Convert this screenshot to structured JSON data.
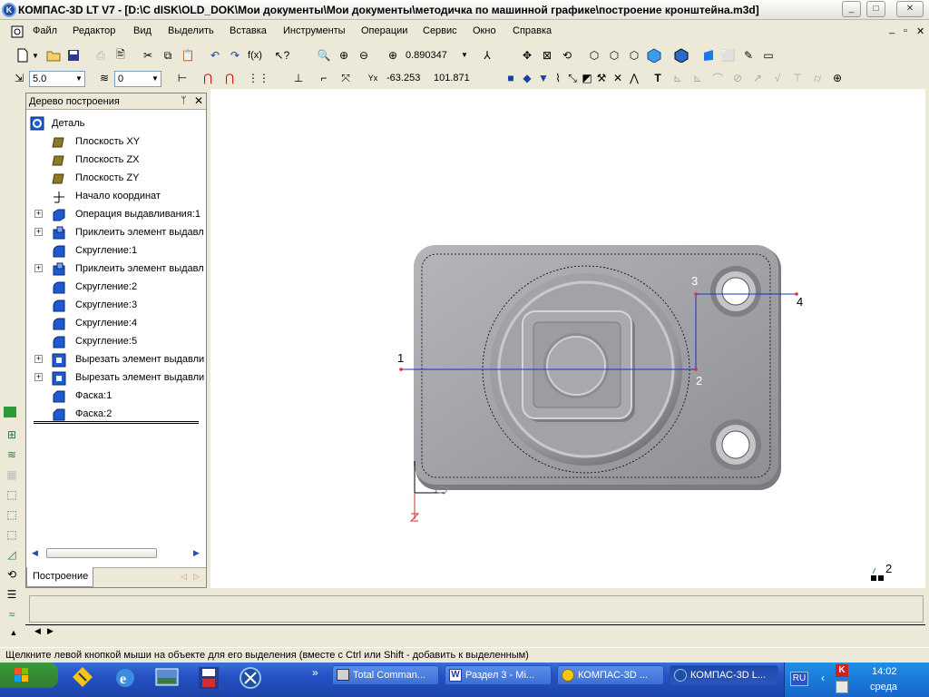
{
  "window": {
    "title": "КОМПАС-3D LT V7 - [D:\\С dISK\\OLD_DOK\\Мои документы\\Мои документы\\методичка по машинной графике\\построение кронштейна.m3d]"
  },
  "menu": [
    "Файл",
    "Редактор",
    "Вид",
    "Выделить",
    "Вставка",
    "Инструменты",
    "Операции",
    "Сервис",
    "Окно",
    "Справка"
  ],
  "toolbar": {
    "scale_value": "0.890347",
    "step_value": "5.0",
    "layer_value": "0",
    "cursor_x": "-63.253",
    "cursor_y": "101.871"
  },
  "tree": {
    "header": "Дерево построения",
    "root": "Деталь",
    "items": [
      {
        "label": "Плоскость XY",
        "expand": false,
        "icon": "plane-icon"
      },
      {
        "label": "Плоскость ZX",
        "expand": false,
        "icon": "plane-icon"
      },
      {
        "label": "Плоскость ZY",
        "expand": false,
        "icon": "plane-icon"
      },
      {
        "label": "Начало координат",
        "expand": false,
        "icon": "origin-icon"
      },
      {
        "label": "Операция выдавливания:1",
        "expand": true,
        "icon": "extrude-icon"
      },
      {
        "label": "Приклеить элемент выдавл",
        "expand": true,
        "icon": "boss-icon"
      },
      {
        "label": "Скругление:1",
        "expand": false,
        "icon": "fillet-icon"
      },
      {
        "label": "Приклеить элемент выдавл",
        "expand": true,
        "icon": "boss-icon"
      },
      {
        "label": "Скругление:2",
        "expand": false,
        "icon": "fillet-icon"
      },
      {
        "label": "Скругление:3",
        "expand": false,
        "icon": "fillet-icon"
      },
      {
        "label": "Скругление:4",
        "expand": false,
        "icon": "fillet-icon"
      },
      {
        "label": "Скругление:5",
        "expand": false,
        "icon": "fillet-icon"
      },
      {
        "label": "Вырезать элемент выдавли",
        "expand": true,
        "icon": "cut-icon"
      },
      {
        "label": "Вырезать элемент выдавли",
        "expand": true,
        "icon": "cut-icon"
      },
      {
        "label": "Фаска:1",
        "expand": false,
        "icon": "chamfer-icon"
      },
      {
        "label": "Фаска:2",
        "expand": false,
        "icon": "chamfer-icon"
      }
    ],
    "tab": "Построение"
  },
  "canvas": {
    "point_labels": [
      "1",
      "2",
      "3",
      "4"
    ],
    "corner_label": "2"
  },
  "status": {
    "message": "Щелкните левой кнопкой мыши на объекте для его выделения (вместе с Ctrl или Shift - добавить к выделенным)"
  },
  "taskbar": {
    "buttons": [
      "Total Comman...",
      "Раздел 3 - Mi...",
      "КОМПАС-3D ...",
      "КОМПАС-3D L..."
    ],
    "lang": "RU",
    "time": "14:02",
    "day": "среда",
    "chevron": "»"
  },
  "colors": {
    "accent": "#2551c4",
    "model_gray": "#9c9da2",
    "sketch_blue": "#1a2fd0"
  }
}
